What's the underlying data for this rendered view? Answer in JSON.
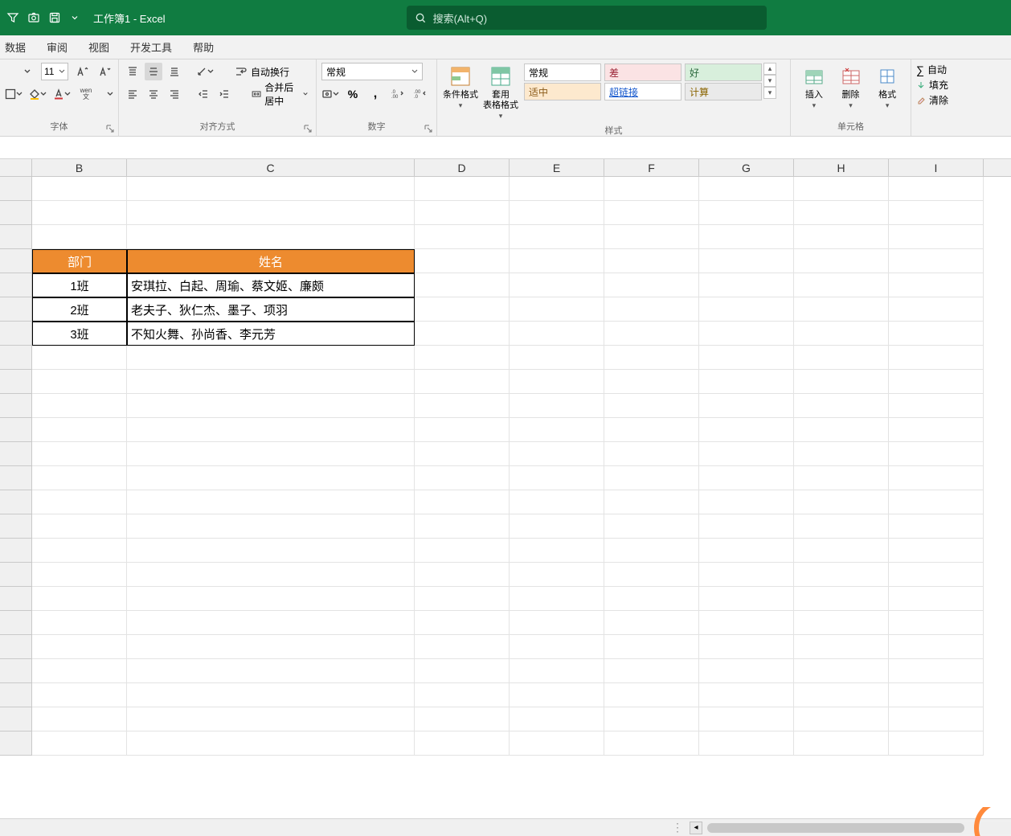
{
  "title": "工作簿1 - Excel",
  "search_placeholder": "搜索(Alt+Q)",
  "menu": {
    "data": "数据",
    "review": "审阅",
    "view": "视图",
    "dev": "开发工具",
    "help": "帮助"
  },
  "ribbon": {
    "font_group": "字体",
    "align_group": "对齐方式",
    "number_group": "数字",
    "styles_group": "样式",
    "cells_group": "单元格",
    "font_size": "11",
    "wrap": "自动换行",
    "merge": "合并后居中",
    "num_format": "常规",
    "cond_fmt": "条件格式",
    "table_fmt_top": "套用",
    "table_fmt_bot": "表格格式",
    "style_normal": "常规",
    "style_bad": "差",
    "style_good": "好",
    "style_neutral": "适中",
    "style_link": "超链接",
    "style_calc": "计算",
    "insert": "插入",
    "delete": "删除",
    "format": "格式",
    "autosum": "自动",
    "fill": "填充",
    "clear": "清除",
    "wen": "wen"
  },
  "columns": [
    "B",
    "C",
    "D",
    "E",
    "F",
    "G",
    "H",
    "I"
  ],
  "table": {
    "headers": {
      "dept": "部门",
      "name": "姓名"
    },
    "rows": [
      {
        "dept": "1班",
        "names": "安琪拉、白起、周瑜、蔡文姬、廉颇"
      },
      {
        "dept": "2班",
        "names": "老夫子、狄仁杰、墨子、项羽"
      },
      {
        "dept": "3班",
        "names": "不知火舞、孙尚香、李元芳"
      }
    ]
  }
}
